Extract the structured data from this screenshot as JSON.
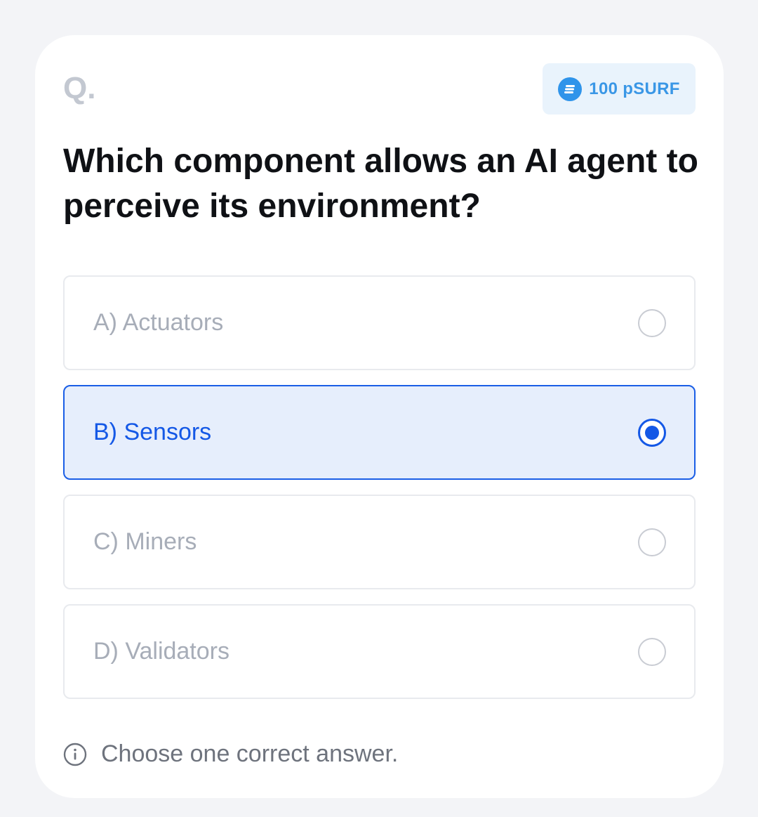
{
  "question": {
    "marker": "Q.",
    "text": "Which component allows an AI agent to perceive its environment?"
  },
  "reward": {
    "icon": "coin-icon",
    "label": "100 pSURF",
    "color": "#2f94ea"
  },
  "options": [
    {
      "label": "A) Actuators",
      "selected": false
    },
    {
      "label": "B) Sensors",
      "selected": true
    },
    {
      "label": "C) Miners",
      "selected": false
    },
    {
      "label": "D) Validators",
      "selected": false
    }
  ],
  "hint": {
    "icon": "info-icon",
    "text": "Choose one correct answer."
  },
  "colors": {
    "accent": "#1458e6",
    "selected_bg": "#e6eefc",
    "background": "#f3f4f7"
  }
}
